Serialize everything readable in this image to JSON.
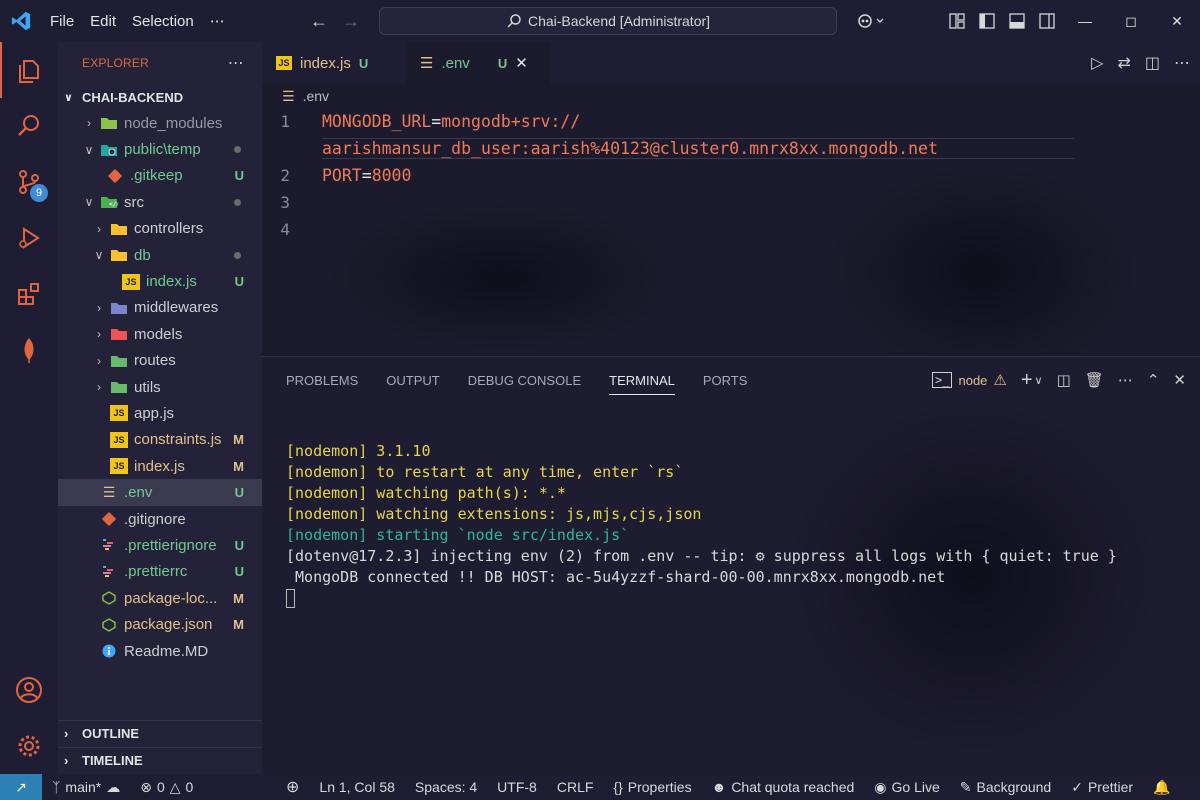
{
  "menu": {
    "file": "File",
    "edit": "Edit",
    "selection": "Selection",
    "more": "⋯"
  },
  "command_center": {
    "text": "Chai-Backend [Administrator]"
  },
  "activity": {
    "scm_badge": "9"
  },
  "explorer": {
    "title": "EXPLORER",
    "more": "⋯",
    "project": "CHAI-BACKEND",
    "rows": [
      {
        "name": "node_modules",
        "status": ""
      },
      {
        "name": "public\\temp",
        "status": "dot"
      },
      {
        "name": ".gitkeep",
        "status": "U"
      },
      {
        "name": "src",
        "status": "dot"
      },
      {
        "name": "controllers",
        "status": ""
      },
      {
        "name": "db",
        "status": "dot"
      },
      {
        "name": "index.js",
        "status": "U"
      },
      {
        "name": "middlewares",
        "status": ""
      },
      {
        "name": "models",
        "status": ""
      },
      {
        "name": "routes",
        "status": ""
      },
      {
        "name": "utils",
        "status": ""
      },
      {
        "name": "app.js",
        "status": ""
      },
      {
        "name": "constraints.js",
        "status": "M"
      },
      {
        "name": "index.js",
        "status": "M"
      },
      {
        "name": ".env",
        "status": "U"
      },
      {
        "name": ".gitignore",
        "status": ""
      },
      {
        "name": ".prettierignore",
        "status": "U"
      },
      {
        "name": ".prettierrc",
        "status": "U"
      },
      {
        "name": "package-loc...",
        "status": "M"
      },
      {
        "name": "package.json",
        "status": "M"
      },
      {
        "name": "Readme.MD",
        "status": ""
      }
    ],
    "outline": "OUTLINE",
    "timeline": "TIMELINE"
  },
  "tabs": [
    {
      "label": "index.js",
      "status": "U"
    },
    {
      "label": ".env",
      "status": "U"
    }
  ],
  "breadcrumb": ".env",
  "code": {
    "line1_num": "1",
    "line1_key": "MONGODB_URL",
    "line1_eq": "=",
    "line1_val": "mongodb+srv://",
    "line1_wrap": "aarishmansur_db_user:aarish%40123@cluster0.mnrx8xx.mongodb.net",
    "line2_num": "2",
    "line2_key": "PORT",
    "line2_eq": "=",
    "line2_val": "8000",
    "line3_num": "3",
    "line4_num": "4"
  },
  "panel": {
    "tabs": [
      "PROBLEMS",
      "OUTPUT",
      "DEBUG CONSOLE",
      "TERMINAL",
      "PORTS"
    ],
    "terminal_name": "node"
  },
  "terminal": {
    "l1": "[nodemon] 3.1.10",
    "l2": "[nodemon] to restart at any time, enter `rs`",
    "l3": "[nodemon] watching path(s): *.*",
    "l4": "[nodemon] watching extensions: js,mjs,cjs,json",
    "l5": "[nodemon] starting `node src/index.js`",
    "l6a": "[dotenv@17.2.3] injecting env (2) from .env -- tip: ",
    "l6b": " suppress all logs with { quiet: true }",
    "l7": " MongoDB connected !! DB HOST: ac-5u4yzzf-shard-00-00.mnrx8xx.mongodb.net"
  },
  "status": {
    "branch": "main*",
    "errors": "0",
    "warnings": "0",
    "position": "Ln 1, Col 58",
    "spaces": "Spaces: 4",
    "encoding": "UTF-8",
    "eol": "CRLF",
    "language": "Properties",
    "chat": "Chat quota reached",
    "golive": "Go Live",
    "background": "Background",
    "prettier": "Prettier"
  },
  "colors": {
    "accent": "#e0663f",
    "modified": "#e2c08d",
    "untracked": "#73c991",
    "remote": "#2c80b3"
  }
}
